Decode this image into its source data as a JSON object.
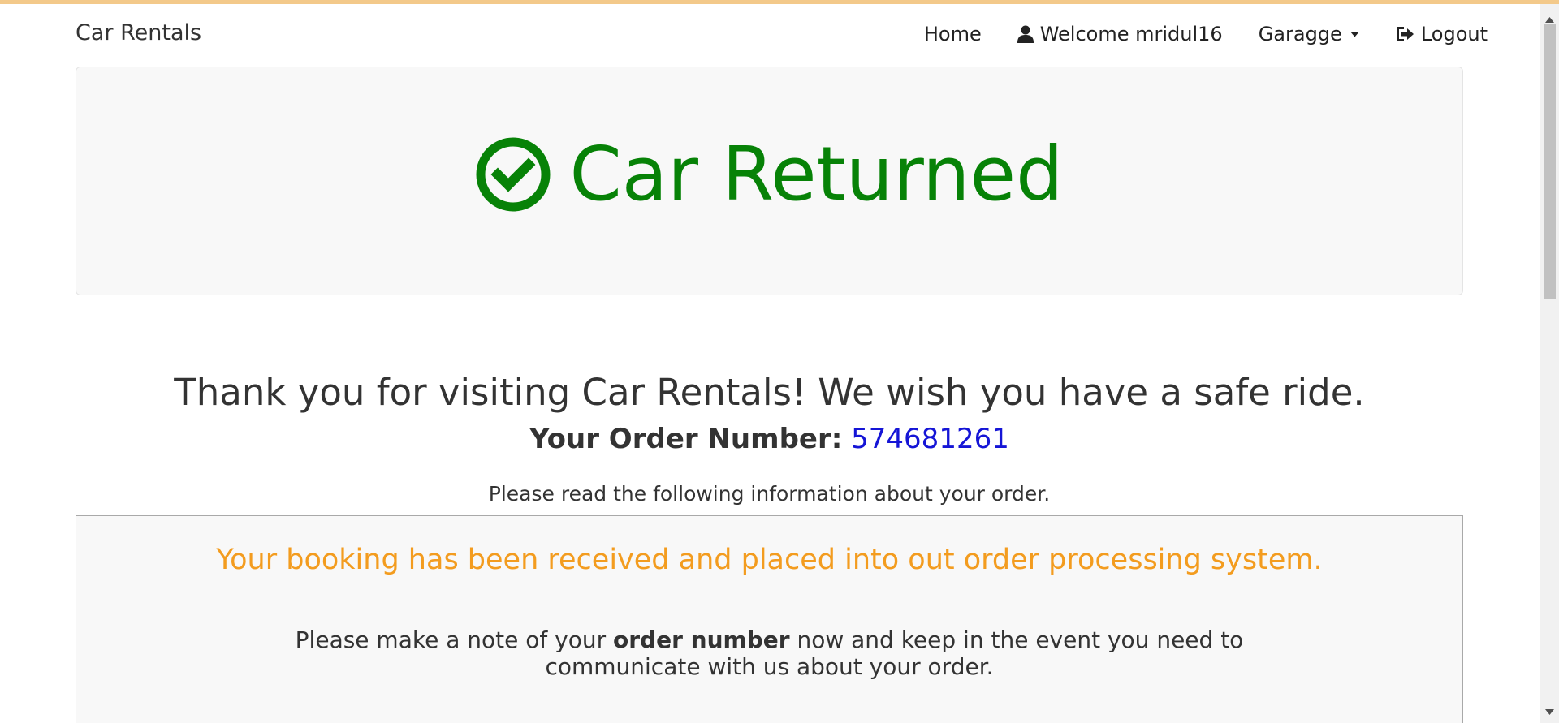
{
  "navbar": {
    "brand": "Car Rentals",
    "home": "Home",
    "welcome": "Welcome mridul16",
    "garage": "Garagge",
    "logout": "Logout"
  },
  "jumbotron": {
    "title": "Car Returned"
  },
  "thanks": "Thank you for visiting Car Rentals! We wish you have a safe ride.",
  "order": {
    "label": "Your Order Number:",
    "number": "574681261"
  },
  "please_read": "Please read the following information about your order.",
  "info": {
    "booking": "Your booking has been received and placed into out order processing system.",
    "note_prefix": "Please make a note of your ",
    "note_bold": "order number",
    "note_suffix": " now and keep in the event you need to communicate with us about your order."
  },
  "colors": {
    "success": "#078207",
    "order_number": "#1515d6",
    "booking": "#f39c1f"
  }
}
